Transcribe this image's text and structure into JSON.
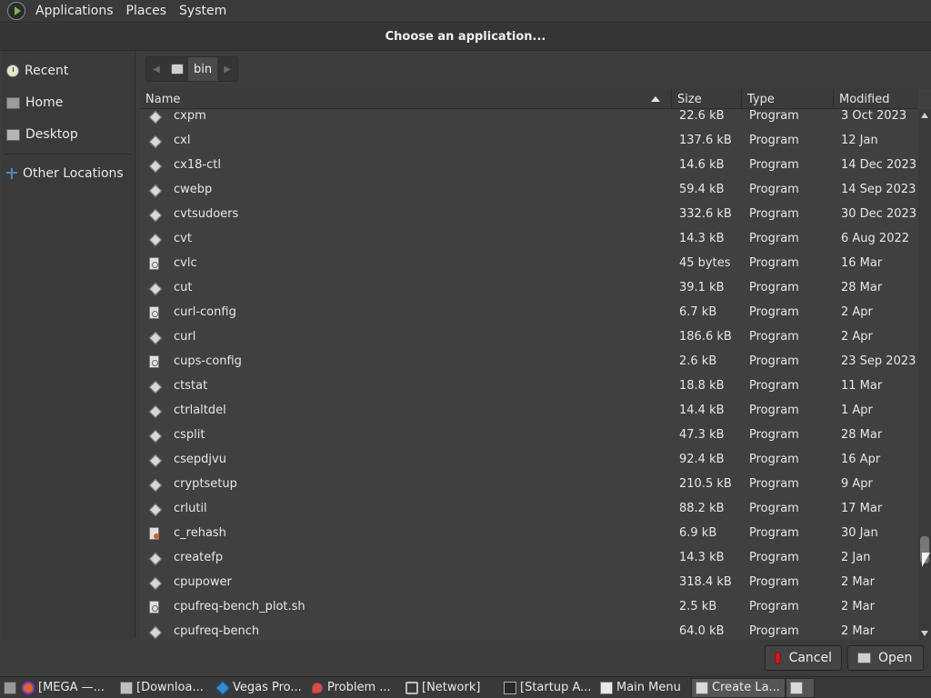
{
  "top_panel": {
    "menus": [
      "Applications",
      "Places",
      "System"
    ]
  },
  "dialog": {
    "title": "Choose an application...",
    "sidebar": {
      "items": [
        {
          "label": "Recent",
          "icon": "clock-icon"
        },
        {
          "label": "Home",
          "icon": "home-folder-icon"
        },
        {
          "label": "Desktop",
          "icon": "desktop-icon"
        },
        {
          "label": "Other Locations",
          "icon": "network-icon"
        }
      ]
    },
    "pathbar": {
      "current": "bin"
    },
    "columns": {
      "name": "Name",
      "size": "Size",
      "type": "Type",
      "modified": "Modified"
    },
    "files": [
      {
        "name": "cxpm",
        "size": "22.6 kB",
        "type": "Program",
        "modified": "3 Oct 2023",
        "icon": "exec"
      },
      {
        "name": "cxl",
        "size": "137.6 kB",
        "type": "Program",
        "modified": "12 Jan",
        "icon": "exec"
      },
      {
        "name": "cx18-ctl",
        "size": "14.6 kB",
        "type": "Program",
        "modified": "14 Dec 2023",
        "icon": "exec"
      },
      {
        "name": "cwebp",
        "size": "59.4 kB",
        "type": "Program",
        "modified": "14 Sep 2023",
        "icon": "exec"
      },
      {
        "name": "cvtsudoers",
        "size": "332.6 kB",
        "type": "Program",
        "modified": "30 Dec 2023",
        "icon": "exec"
      },
      {
        "name": "cvt",
        "size": "14.3 kB",
        "type": "Program",
        "modified": "6 Aug 2022",
        "icon": "exec"
      },
      {
        "name": "cvlc",
        "size": "45 bytes",
        "type": "Program",
        "modified": "16 Mar",
        "icon": "script"
      },
      {
        "name": "cut",
        "size": "39.1 kB",
        "type": "Program",
        "modified": "28 Mar",
        "icon": "exec"
      },
      {
        "name": "curl-config",
        "size": "6.7 kB",
        "type": "Program",
        "modified": "2 Apr",
        "icon": "script"
      },
      {
        "name": "curl",
        "size": "186.6 kB",
        "type": "Program",
        "modified": "2 Apr",
        "icon": "exec"
      },
      {
        "name": "cups-config",
        "size": "2.6 kB",
        "type": "Program",
        "modified": "23 Sep 2023",
        "icon": "script"
      },
      {
        "name": "ctstat",
        "size": "18.8 kB",
        "type": "Program",
        "modified": "11 Mar",
        "icon": "exec"
      },
      {
        "name": "ctrlaltdel",
        "size": "14.4 kB",
        "type": "Program",
        "modified": "1 Apr",
        "icon": "exec"
      },
      {
        "name": "csplit",
        "size": "47.3 kB",
        "type": "Program",
        "modified": "28 Mar",
        "icon": "exec"
      },
      {
        "name": "csepdjvu",
        "size": "92.4 kB",
        "type": "Program",
        "modified": "16 Apr",
        "icon": "exec"
      },
      {
        "name": "cryptsetup",
        "size": "210.5 kB",
        "type": "Program",
        "modified": "9 Apr",
        "icon": "exec"
      },
      {
        "name": "crlutil",
        "size": "88.2 kB",
        "type": "Program",
        "modified": "17 Mar",
        "icon": "exec"
      },
      {
        "name": "c_rehash",
        "size": "6.9 kB",
        "type": "Program",
        "modified": "30 Jan",
        "icon": "perl"
      },
      {
        "name": "createfp",
        "size": "14.3 kB",
        "type": "Program",
        "modified": "2 Jan",
        "icon": "exec"
      },
      {
        "name": "cpupower",
        "size": "318.4 kB",
        "type": "Program",
        "modified": "2 Mar",
        "icon": "exec"
      },
      {
        "name": "cpufreq-bench_plot.sh",
        "size": "2.5 kB",
        "type": "Program",
        "modified": "2 Mar",
        "icon": "script"
      },
      {
        "name": "cpufreq-bench",
        "size": "64.0 kB",
        "type": "Program",
        "modified": "2 Mar",
        "icon": "exec"
      }
    ],
    "buttons": {
      "cancel": "Cancel",
      "open": "Open"
    }
  },
  "taskbar": {
    "tasks": [
      {
        "label": "[MEGA —...",
        "icon": "firefox-icon"
      },
      {
        "label": "[Downloa...",
        "icon": "folder-icon"
      },
      {
        "label": "Vegas Pro...",
        "icon": "vegas-icon"
      },
      {
        "label": "Problem ...",
        "icon": "problem-icon"
      },
      {
        "label": "[Network]",
        "icon": "network-icon"
      },
      {
        "label": "[Startup A...",
        "icon": "terminal-icon"
      },
      {
        "label": "Main Menu",
        "icon": "menu-editor-icon"
      },
      {
        "label": "Create La...",
        "icon": "launcher-icon"
      }
    ]
  },
  "colors": {
    "background": "#3c3c3c",
    "list_background": "#404040",
    "text": "#e6e6e6",
    "cancel_icon": "#cc1b1b"
  }
}
